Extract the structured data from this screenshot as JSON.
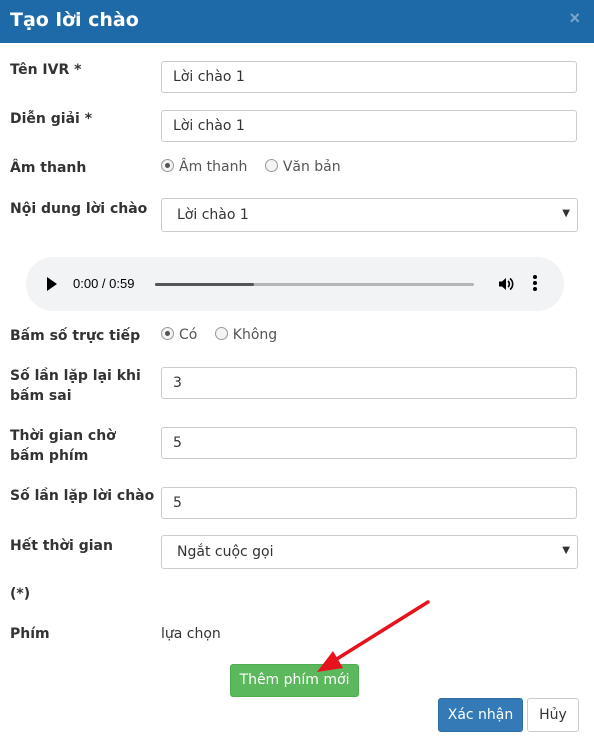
{
  "dialog": {
    "title": "Tạo lời chào",
    "close_label": "×"
  },
  "form": {
    "ivr_name": {
      "label": "Tên IVR *",
      "value": "Lời chào 1"
    },
    "description": {
      "label": "Diễn giải *",
      "value": "Lời chào 1"
    },
    "sound": {
      "label": "Âm thanh",
      "options": [
        "Âm thanh",
        "Văn bản"
      ],
      "selected": "Âm thanh"
    },
    "greeting_content": {
      "label": "Nội dung lời chào",
      "value": "Lời chào 1"
    },
    "audio_player": {
      "time": "0:00 / 0:59",
      "progress": 0.31
    },
    "direct_dial": {
      "label": "Bấm số trực tiếp",
      "options": [
        "Có",
        "Không"
      ],
      "selected": "Có"
    },
    "retry_on_wrong": {
      "label_line1": "Số lần lặp lại khi",
      "label_line2": "bấm sai",
      "value": "3"
    },
    "wait_time": {
      "label_line1": "Thời gian chờ",
      "label_line2": "bấm phím",
      "value": "5"
    },
    "greeting_repeat": {
      "label": "Số lần lặp lời chào",
      "value": "5"
    },
    "timeout": {
      "label": "Hết thời gian",
      "value": "Ngắt cuộc gọi"
    },
    "note": "(*)",
    "key_table": {
      "col_key": "Phím",
      "col_choice": "lựa chọn"
    }
  },
  "buttons": {
    "add_key": "Thêm phím mới",
    "confirm": "Xác nhận",
    "cancel": "Hủy"
  },
  "colors": {
    "header": "#1e6aa8",
    "green": "#5cb85c",
    "blue": "#337ab7",
    "arrow": "#e8121c"
  }
}
